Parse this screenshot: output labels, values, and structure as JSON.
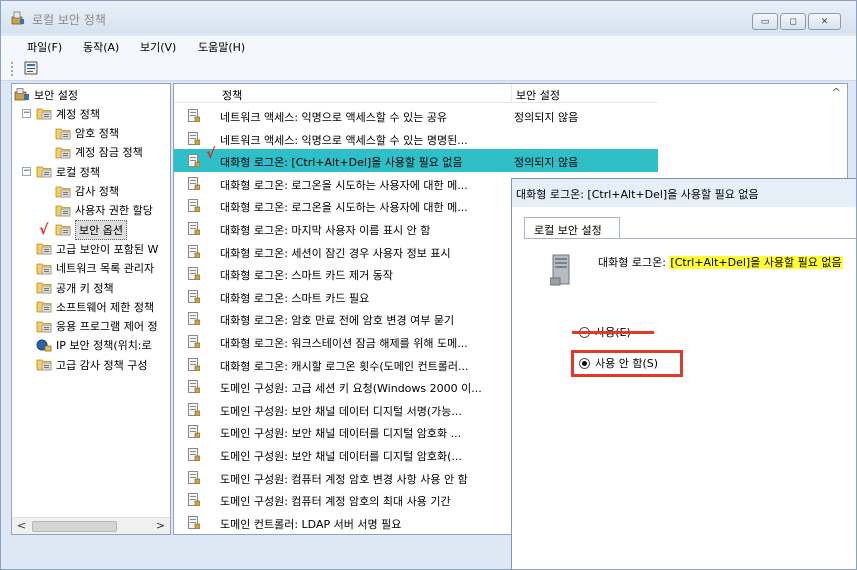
{
  "window": {
    "title": "로컬 보안 정책",
    "minimize_glyph": "▭",
    "maximize_glyph": "◻",
    "close_glyph": "✕"
  },
  "menu": [
    {
      "label": "파일(F)"
    },
    {
      "label": "동작(A)"
    },
    {
      "label": "보기(V)"
    },
    {
      "label": "도움말(H)"
    }
  ],
  "tree": {
    "items": [
      {
        "label": "보안 설정",
        "expander": "",
        "indent": 0,
        "icon": "security-settings-icon"
      },
      {
        "label": "계정 정책",
        "expander": "−",
        "indent": 1,
        "icon": "folder-icon"
      },
      {
        "label": "암호 정책",
        "expander": "",
        "indent": 2,
        "icon": "folder-icon"
      },
      {
        "label": "계정 잠금 정책",
        "expander": "",
        "indent": 2,
        "icon": "folder-icon"
      },
      {
        "label": "로컬 정책",
        "expander": "−",
        "indent": 1,
        "icon": "folder-icon"
      },
      {
        "label": "감사 정책",
        "expander": "",
        "indent": 2,
        "icon": "folder-icon"
      },
      {
        "label": "사용자 권한 할당",
        "expander": "",
        "indent": 2,
        "icon": "folder-icon"
      },
      {
        "label": "보안 옵션",
        "expander": "",
        "indent": 2,
        "icon": "folder-icon",
        "selected": true
      },
      {
        "label": "고급 보안이 포함된 W",
        "expander": "",
        "indent": 1,
        "icon": "folder-icon"
      },
      {
        "label": "네트워크 목록 관리자",
        "expander": "",
        "indent": 1,
        "icon": "folder-icon"
      },
      {
        "label": "공개 키 정책",
        "expander": "",
        "indent": 1,
        "icon": "folder-icon"
      },
      {
        "label": "소프트웨어 제한 정책",
        "expander": "",
        "indent": 1,
        "icon": "folder-icon"
      },
      {
        "label": "응용 프로그램 제어 정",
        "expander": "",
        "indent": 1,
        "icon": "folder-icon"
      },
      {
        "label": "IP 보안 정책(위치:로",
        "expander": "",
        "indent": 1,
        "icon": "ip-security-icon"
      },
      {
        "label": "고급 감사 정책 구성",
        "expander": "",
        "indent": 1,
        "icon": "folder-icon"
      }
    ],
    "scroll_left": "<",
    "scroll_right": ">"
  },
  "list": {
    "columns": {
      "policy": "정책",
      "setting": "보안 설정"
    },
    "scroll_up": "^",
    "rows": [
      {
        "name": "네트워크 액세스: 익명으로 액세스할 수 있는 공유",
        "value": "정의되지 않음"
      },
      {
        "name": "네트워크 액세스: 익명으로 액세스할 수 있는 명명된...",
        "value": ""
      },
      {
        "name": "대화형 로그온: [Ctrl+Alt+Del]을 사용할 필요 없음",
        "value": "정의되지 않음",
        "selected": true
      },
      {
        "name": "대화형 로그온: 로그온을 시도하는 사용자에 대한 메...",
        "value": ""
      },
      {
        "name": "대화형 로그온: 로그온을 시도하는 사용자에 대한 메...",
        "value": ""
      },
      {
        "name": "대화형 로그온: 마지막 사용자 이름 표시 안 함",
        "value": ""
      },
      {
        "name": "대화형 로그온: 세션이 잠긴 경우 사용자 정보 표시",
        "value": ""
      },
      {
        "name": "대화형 로그온: 스마트 카드 제거 동작",
        "value": ""
      },
      {
        "name": "대화형 로그온: 스마트 카드 필요",
        "value": ""
      },
      {
        "name": "대화형 로그온: 암호 만료 전에 암호 변경 여부 묻기",
        "value": ""
      },
      {
        "name": "대화형 로그온: 워크스테이션 잠금 해제를 위해 도메...",
        "value": ""
      },
      {
        "name": "대화형 로그온: 캐시할 로그온 횟수(도메인 컨트롤러...",
        "value": ""
      },
      {
        "name": "도메인 구성원: 고급 세션 키 요청(Windows 2000 이...",
        "value": ""
      },
      {
        "name": "도메인 구성원: 보안 채널 데이터 디지털 서명(가능...",
        "value": ""
      },
      {
        "name": "도메인 구성원: 보안 채널 데이터를 디지털 암호화 ...",
        "value": ""
      },
      {
        "name": "도메인 구성원: 보안 채널 데이터를 디지털 암호화(...",
        "value": ""
      },
      {
        "name": "도메인 구성원: 컴퓨터 계정 암호 변경 사항 사용 안 함",
        "value": ""
      },
      {
        "name": "도메인 구성원: 컴퓨터 계정 암호의 최대 사용 기간",
        "value": ""
      },
      {
        "name": "도메인 컨트롤러: LDAP 서버 서명 필요",
        "value": ""
      }
    ]
  },
  "annotations": {
    "tree_check": "√",
    "row_check": "√"
  },
  "dialog": {
    "title": "대화형 로그온: [Ctrl+Alt+Del]을 사용할 필요 없음",
    "tab": "로컬 보안 설정",
    "policy_prefix": "대화형 로그온: ",
    "policy_highlight": "[Ctrl+Alt+Del]을 사용할 필요 없음",
    "radio_enable": "사용(E)",
    "radio_disable": "사용 안 함(S)",
    "selected": "disable"
  },
  "colors": {
    "selection": "#2fbfc9",
    "highlight": "#ffff33",
    "annotation_red": "#e23a2a"
  }
}
